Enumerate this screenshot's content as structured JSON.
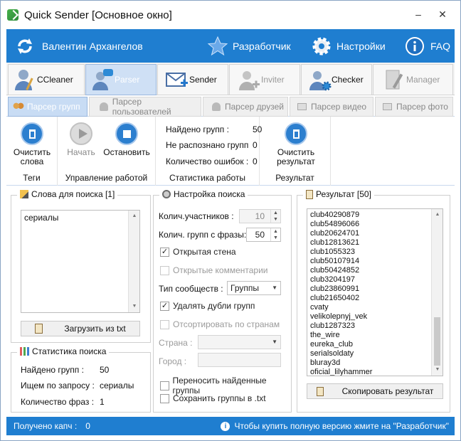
{
  "window": {
    "title": "Quick Sender [Основное окно]",
    "minimize": "–",
    "close": "✕"
  },
  "topbar": {
    "user": "Валентин Архангелов",
    "developer": "Разработчик",
    "settings": "Настройки",
    "faq": "FAQ"
  },
  "modules": [
    {
      "label": "CCleaner",
      "state": "normal"
    },
    {
      "label": "Parser",
      "state": "active"
    },
    {
      "label": "Sender",
      "state": "normal"
    },
    {
      "label": "Inviter",
      "state": "disabled"
    },
    {
      "label": "Checker",
      "state": "normal"
    },
    {
      "label": "Manager",
      "state": "disabled"
    }
  ],
  "subtabs": [
    "Парсер групп",
    "Парсер пользователей",
    "Парсер друзей",
    "Парсер видео",
    "Парсер фото"
  ],
  "ribbon": {
    "tags": {
      "clear_words": "Очистить слова",
      "caption": "Теги"
    },
    "control": {
      "start": "Начать",
      "stop": "Остановить",
      "caption": "Управление работой"
    },
    "stats": {
      "found_label": "Найдено групп :",
      "found_value": "50",
      "unrecognized_label": "Не распознано групп",
      "unrecognized_value": "0",
      "errors_label": "Количество ошибок :",
      "errors_value": "0",
      "caption": "Статистика работы"
    },
    "result": {
      "clear_result": "Очистить результат",
      "caption": "Результат"
    }
  },
  "words_panel": {
    "title": "Слова для поиска [1]",
    "text": "сериалы",
    "load_button": "Загрузить из txt"
  },
  "search_stats": {
    "title": "Статистика поиска",
    "found_label": "Найдено групп :",
    "found_value": "50",
    "query_label": "Ищем по запросу :",
    "query_value": "сериалы",
    "phrases_label": "Количество фраз :",
    "phrases_value": "1"
  },
  "search_settings": {
    "title": "Настройка поиска",
    "members_label": "Колич.участников :",
    "members_value": "10",
    "groups_label": "Колич. групп с фразы:",
    "groups_value": "50",
    "open_wall": "Открытая стена",
    "open_comments": "Открытые комментарии",
    "community_type_label": "Тип сообществ :",
    "community_type_value": "Группы",
    "remove_duplicates": "Удалять дубли групп",
    "sort_by_country": "Отсортировать по странам",
    "country_label": "Страна :",
    "city_label": "Город :",
    "move_found": "Переносить найденные группы",
    "save_txt": "Сохранить группы в .txt"
  },
  "result_panel": {
    "title": "Результат [50]",
    "items": [
      "club40290879",
      "club54896066",
      "club20624701",
      "club12813621",
      "club1055323",
      "club50107914",
      "club50424852",
      "club3204197",
      "club23860991",
      "club21650402",
      "cvaty",
      "velikolepnyj_vek",
      "club1287323",
      "the_wire",
      "eureka_club",
      "serialsoldaty",
      "bluray3d",
      "oficial_lilyhammer"
    ],
    "copy_button": "Скопировать результат"
  },
  "statusbar": {
    "captcha_label": "Получено капч :",
    "captcha_value": "0",
    "hint": "Чтобы купить полную версию жмите на \"Разработчик\""
  },
  "colors": {
    "accent": "#1f7ed0",
    "active_tab": "#cfe0f5"
  }
}
